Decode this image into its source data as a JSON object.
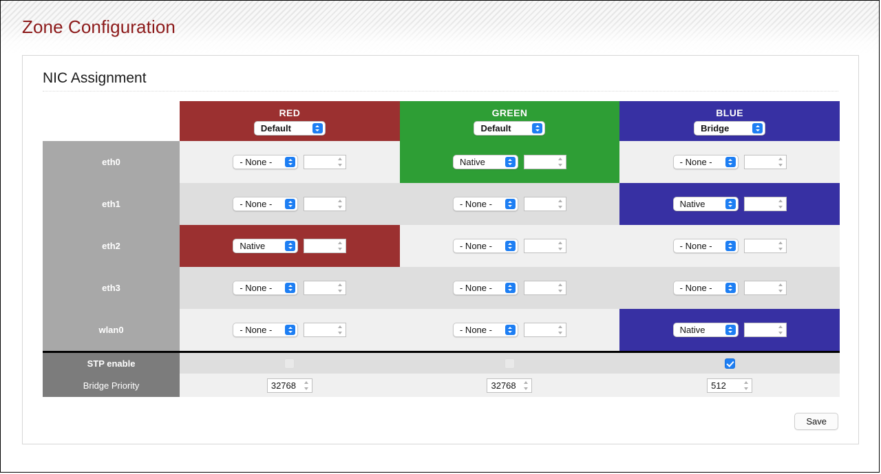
{
  "banner": {
    "title": "Zone Configuration"
  },
  "panel": {
    "heading": "NIC Assignment",
    "save_label": "Save"
  },
  "colors": {
    "red": "#9b3030",
    "green": "#2e9e35",
    "blue": "#3730a3",
    "accent_blue": "#1d7ef3",
    "title_red": "#8c1919",
    "label_gray": "#a8a8a8",
    "footer_label_gray": "#7c7c7c"
  },
  "zones": [
    {
      "name": "RED",
      "mode": "Default"
    },
    {
      "name": "GREEN",
      "mode": "Default"
    },
    {
      "name": "BLUE",
      "mode": "Bridge"
    }
  ],
  "nic_rows": [
    {
      "label": "eth0",
      "cells": [
        {
          "select": "- None -",
          "vlan": "",
          "active": false
        },
        {
          "select": "Native",
          "vlan": "",
          "active": true
        },
        {
          "select": "- None -",
          "vlan": "",
          "active": false
        }
      ]
    },
    {
      "label": "eth1",
      "cells": [
        {
          "select": "- None -",
          "vlan": "",
          "active": false
        },
        {
          "select": "- None -",
          "vlan": "",
          "active": false
        },
        {
          "select": "Native",
          "vlan": "",
          "active": true
        }
      ]
    },
    {
      "label": "eth2",
      "cells": [
        {
          "select": "Native",
          "vlan": "",
          "active": true
        },
        {
          "select": "- None -",
          "vlan": "",
          "active": false
        },
        {
          "select": "- None -",
          "vlan": "",
          "active": false
        }
      ]
    },
    {
      "label": "eth3",
      "cells": [
        {
          "select": "- None -",
          "vlan": "",
          "active": false
        },
        {
          "select": "- None -",
          "vlan": "",
          "active": false
        },
        {
          "select": "- None -",
          "vlan": "",
          "active": false
        }
      ]
    },
    {
      "label": "wlan0",
      "cells": [
        {
          "select": "- None -",
          "vlan": "",
          "active": false
        },
        {
          "select": "- None -",
          "vlan": "",
          "active": false
        },
        {
          "select": "Native",
          "vlan": "",
          "active": true
        }
      ]
    }
  ],
  "stp": {
    "label": "STP enable",
    "values": [
      false,
      false,
      true
    ]
  },
  "bridge_priority": {
    "label": "Bridge Priority",
    "values": [
      "32768",
      "32768",
      "512"
    ]
  },
  "icons": {
    "select_stepper": "chevron-up-down-icon",
    "number_stepper": "number-stepper-icon",
    "checkmark": "check-icon"
  }
}
